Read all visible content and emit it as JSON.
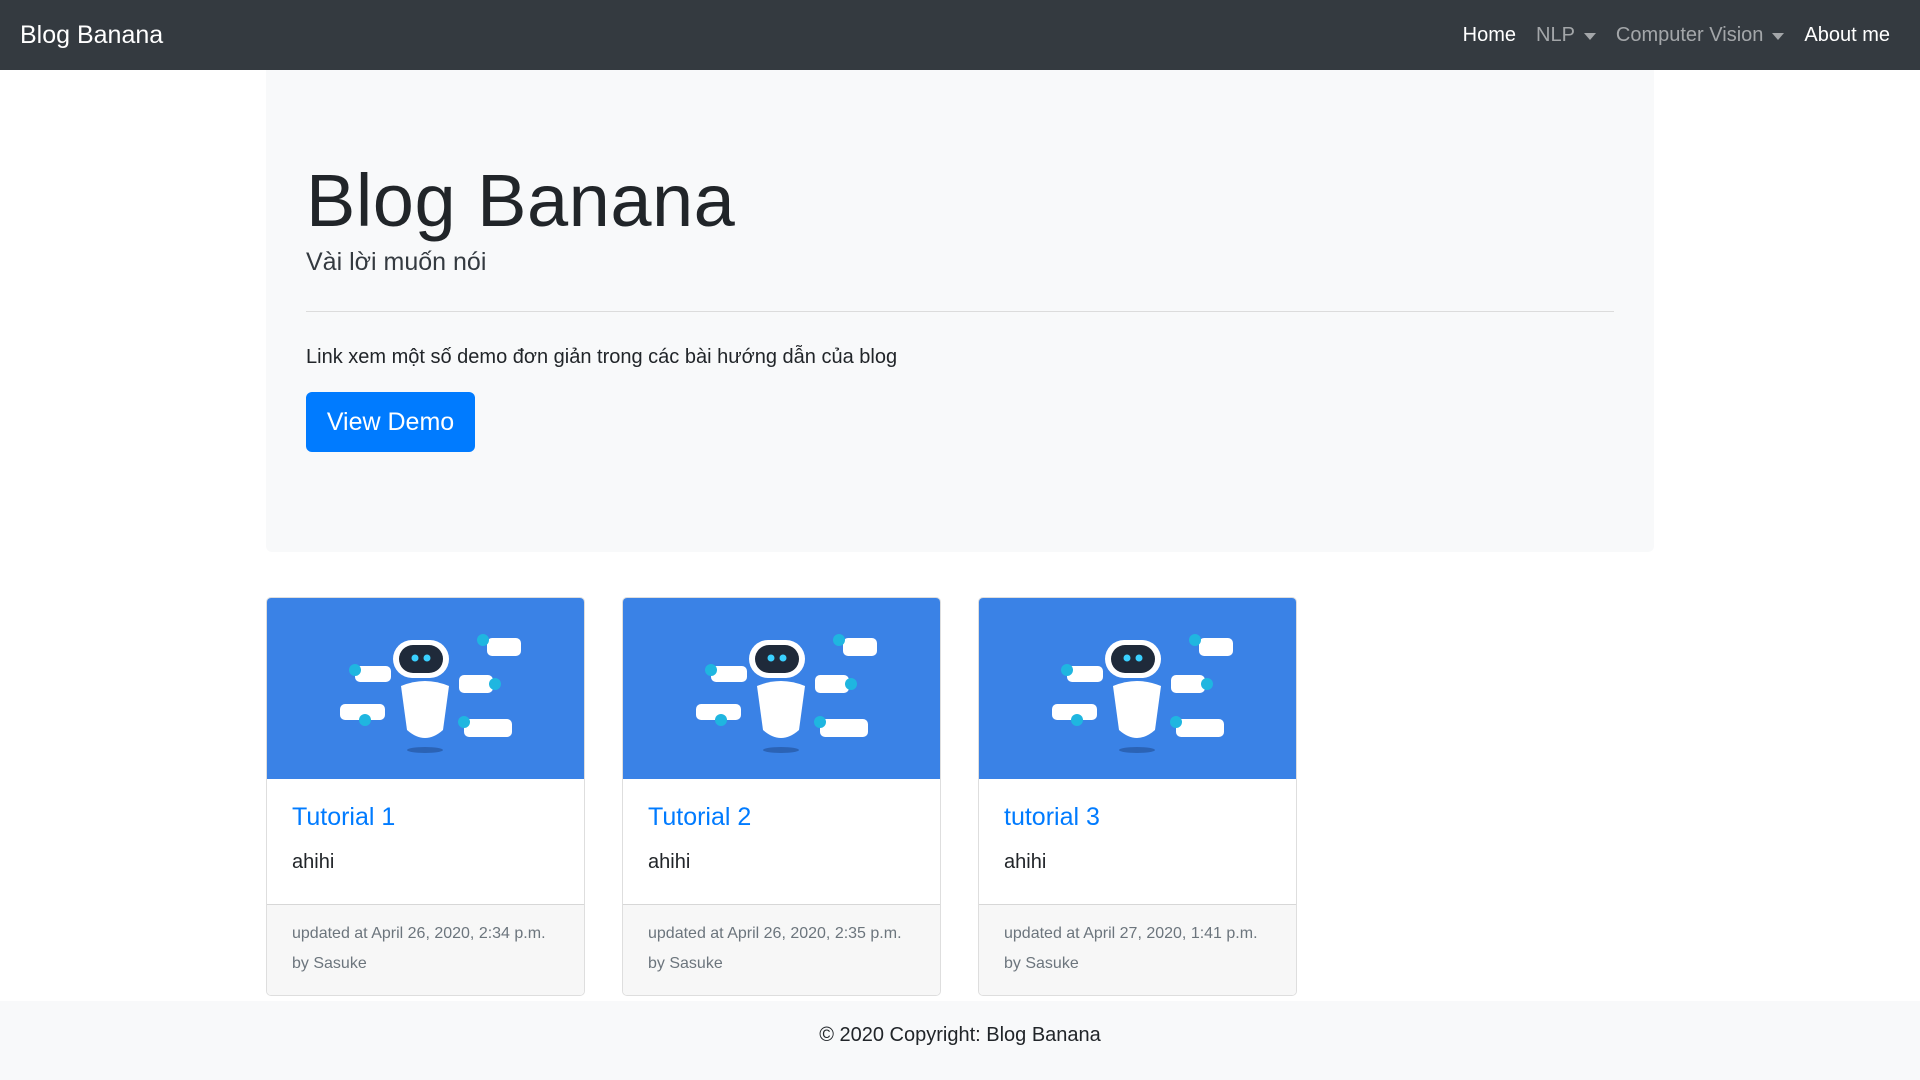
{
  "navbar": {
    "brand": "Blog Banana",
    "items": [
      {
        "label": "Home",
        "active": true,
        "dropdown": false
      },
      {
        "label": "NLP",
        "active": false,
        "dropdown": true
      },
      {
        "label": "Computer Vision",
        "active": false,
        "dropdown": true
      },
      {
        "label": "About me",
        "active": true,
        "dropdown": false
      }
    ]
  },
  "jumbotron": {
    "title": "Blog Banana",
    "subtitle": "Vài lời muốn nói",
    "text": "Link xem một số demo đơn giản trong các bài hướng dẫn của blog",
    "button_label": "View Demo"
  },
  "cards": [
    {
      "title": "Tutorial 1",
      "text": "ahihi",
      "updated": "updated at April 26, 2020, 2:34 p.m.",
      "author": "by Sasuke",
      "image": "chatbot-robot-illustration"
    },
    {
      "title": "Tutorial 2",
      "text": "ahihi",
      "updated": "updated at April 26, 2020, 2:35 p.m.",
      "author": "by Sasuke",
      "image": "chatbot-robot-illustration"
    },
    {
      "title": "tutorial 3",
      "text": "ahihi",
      "updated": "updated at April 27, 2020, 1:41 p.m.",
      "author": "by Sasuke",
      "image": "chatbot-robot-illustration"
    }
  ],
  "footer": {
    "copyright": "© 2020 Copyright: Blog Banana"
  },
  "colors": {
    "navbar_bg": "#343a40",
    "primary": "#007bff",
    "jumbotron_bg": "#f8f9fa",
    "card_image_bg": "#3a82e6"
  }
}
